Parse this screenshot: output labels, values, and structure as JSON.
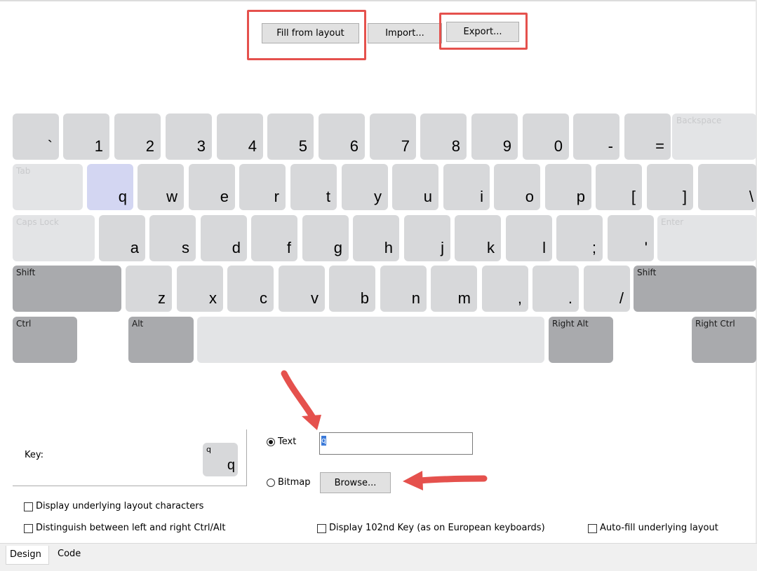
{
  "toolbar": {
    "fill_label": "Fill from layout",
    "import_label": "Import...",
    "export_label": "Export..."
  },
  "keyboard": {
    "row1": [
      "`",
      "1",
      "2",
      "3",
      "4",
      "5",
      "6",
      "7",
      "8",
      "9",
      "0",
      "-",
      "=",
      "Backspace"
    ],
    "row2": [
      "Tab",
      "q",
      "w",
      "e",
      "r",
      "t",
      "y",
      "u",
      "i",
      "o",
      "p",
      "[",
      "]",
      "\\"
    ],
    "row3": [
      "Caps Lock",
      "a",
      "s",
      "d",
      "f",
      "g",
      "h",
      "j",
      "k",
      "l",
      ";",
      "'",
      "Enter"
    ],
    "row4": [
      "Shift",
      "z",
      "x",
      "c",
      "v",
      "b",
      "n",
      "m",
      ",",
      ".",
      "/",
      "Shift"
    ],
    "row5": [
      "Ctrl",
      "Alt",
      "",
      "Right Alt",
      "Right Ctrl"
    ]
  },
  "key_panel": {
    "key_label": "Key:",
    "preview_underlying": "q",
    "preview_char": "q",
    "text_option": "Text",
    "text_value": "q",
    "bitmap_option": "Bitmap",
    "browse_label": "Browse..."
  },
  "options": {
    "display_underlying": "Display underlying layout characters",
    "distinguish_ctrl_alt": "Distinguish between left and right Ctrl/Alt",
    "display_102nd": "Display 102nd Key (as on European keyboards)",
    "auto_fill": "Auto-fill underlying layout"
  },
  "tabs": {
    "design": "Design",
    "code": "Code"
  }
}
